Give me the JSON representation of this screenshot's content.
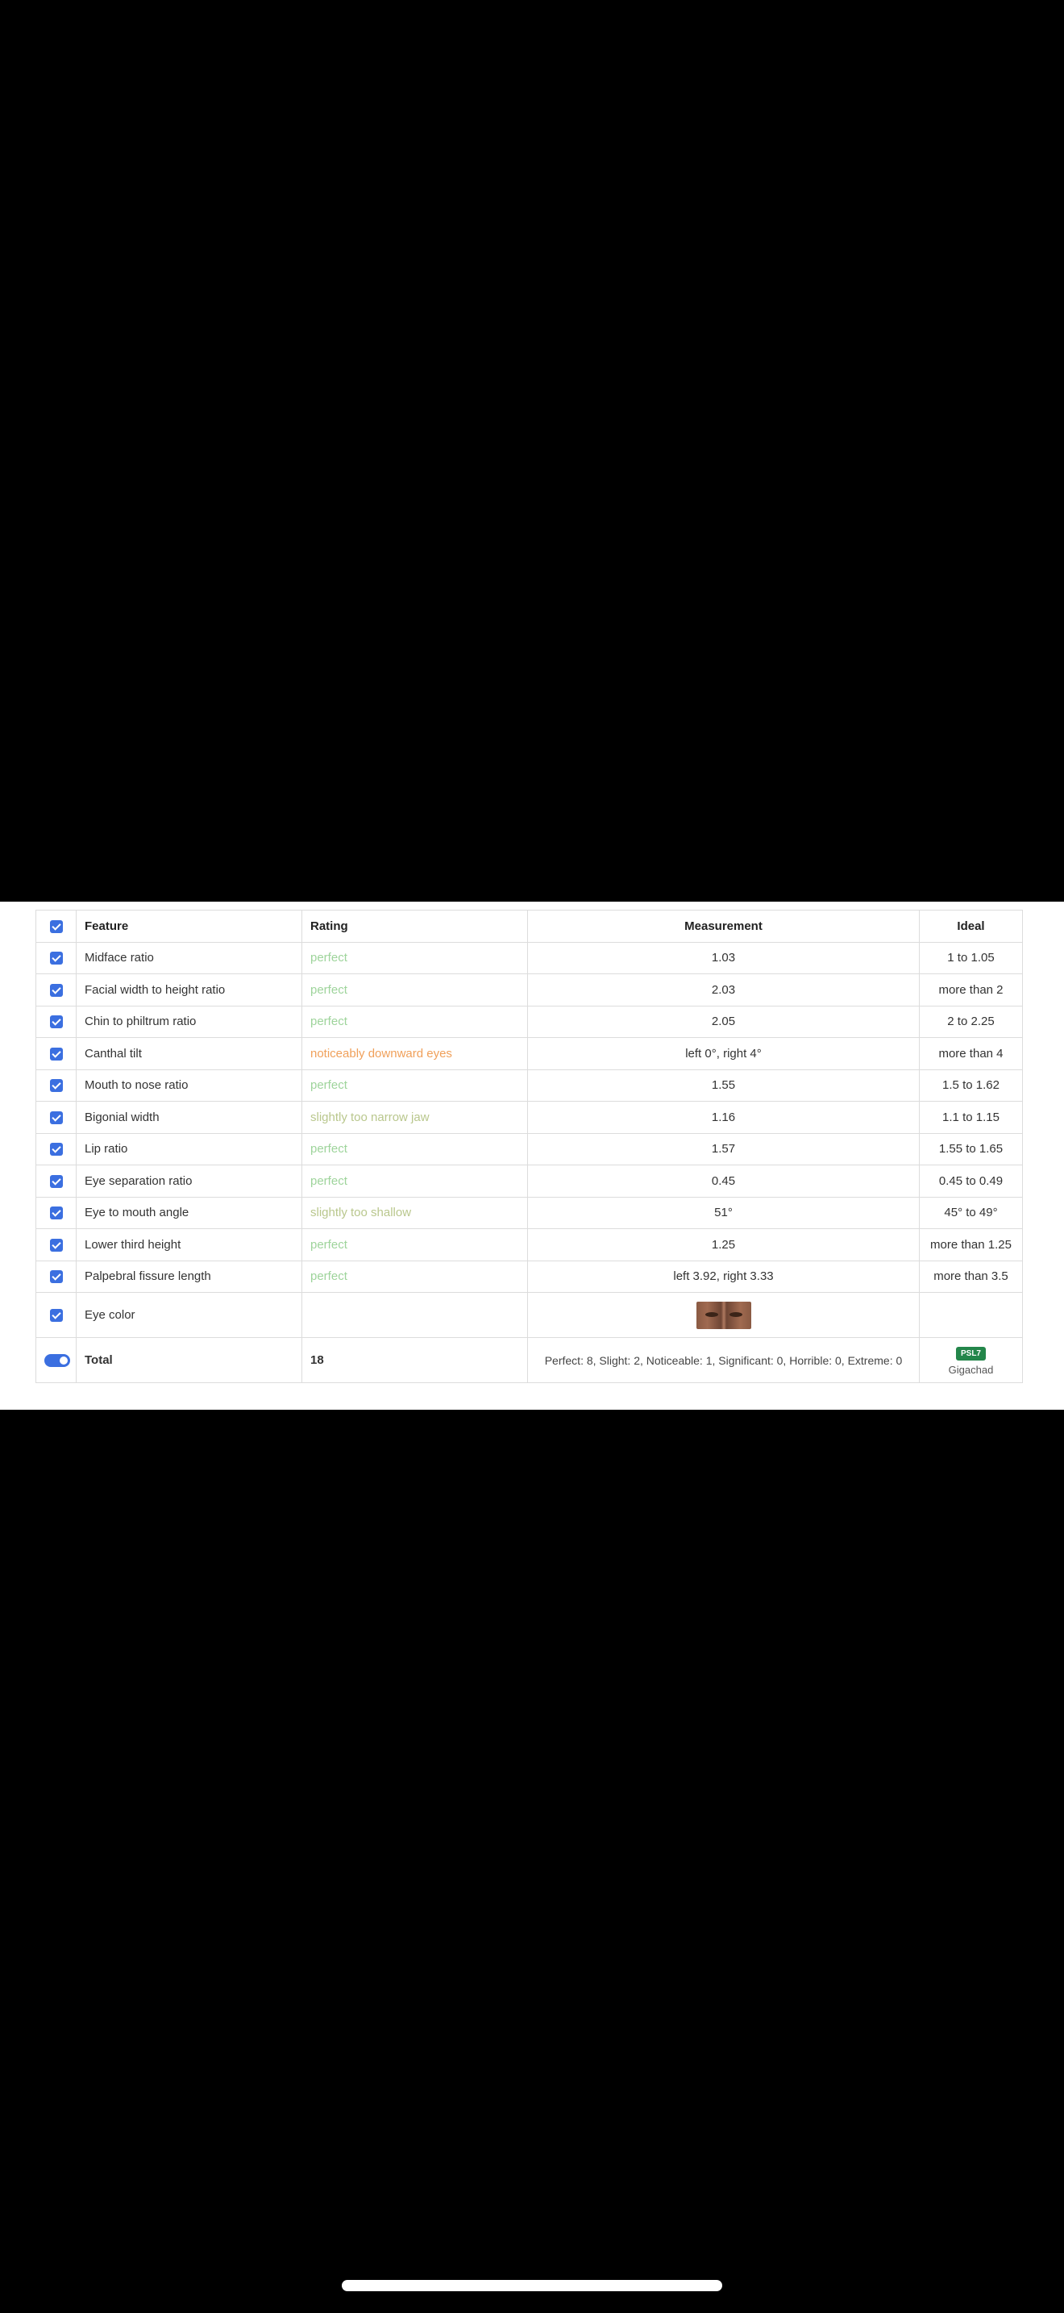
{
  "table": {
    "headers": {
      "feature": "Feature",
      "rating": "Rating",
      "measurement": "Measurement",
      "ideal": "Ideal"
    },
    "rows": [
      {
        "feature": "Midface ratio",
        "rating": "perfect",
        "measurement": "1.03",
        "ideal": "1 to 1.05"
      },
      {
        "feature": "Facial width to height ratio",
        "rating": "perfect",
        "measurement": "2.03",
        "ideal": "more than 2"
      },
      {
        "feature": "Chin to philtrum ratio",
        "rating": "perfect",
        "measurement": "2.05",
        "ideal": "2 to 2.25"
      },
      {
        "feature": "Canthal tilt",
        "rating": "noticeably downward eyes",
        "measurement": "left 0°, right 4°",
        "ideal": "more than 4"
      },
      {
        "feature": "Mouth to nose ratio",
        "rating": "perfect",
        "measurement": "1.55",
        "ideal": "1.5 to 1.62"
      },
      {
        "feature": "Bigonial width",
        "rating": "slightly too narrow jaw",
        "measurement": "1.16",
        "ideal": "1.1 to 1.15"
      },
      {
        "feature": "Lip ratio",
        "rating": "perfect",
        "measurement": "1.57",
        "ideal": "1.55 to 1.65"
      },
      {
        "feature": "Eye separation ratio",
        "rating": "perfect",
        "measurement": "0.45",
        "ideal": "0.45 to 0.49"
      },
      {
        "feature": "Eye to mouth angle",
        "rating": "slightly too shallow",
        "measurement": "51°",
        "ideal": "45° to 49°"
      },
      {
        "feature": "Lower third height",
        "rating": "perfect",
        "measurement": "1.25",
        "ideal": "more than 1.25"
      },
      {
        "feature": "Palpebral fissure length",
        "rating": "perfect",
        "measurement": "left 3.92, right 3.33",
        "ideal": "more than 3.5"
      },
      {
        "feature": "Eye color",
        "rating": "",
        "measurement": "",
        "ideal": ""
      }
    ],
    "total": {
      "label": "Total",
      "score": "18",
      "summary": "Perfect: 8, Slight: 2, Noticeable: 1, Significant: 0, Horrible: 0, Extreme: 0",
      "psl_badge": "PSL7",
      "tier": "Gigachad"
    }
  },
  "colors": {
    "checkbox": "#3b6fe0",
    "rating_perfect": "#9ed49b",
    "rating_slight": "#b9c78d",
    "rating_noticeable": "#f0a05a",
    "psl_badge": "#23864a"
  }
}
